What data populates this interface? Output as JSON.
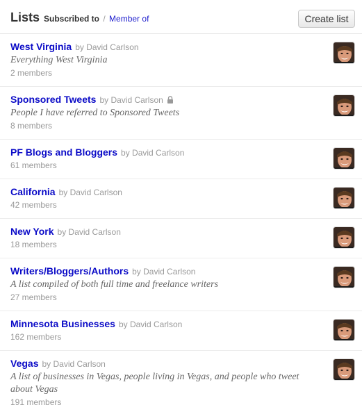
{
  "header": {
    "title": "Lists",
    "tab_subscribed": "Subscribed to",
    "tab_separator": "/",
    "tab_member": "Member of",
    "create_button": "Create list"
  },
  "lists": [
    {
      "name": "West Virginia",
      "by": "by David Carlson",
      "locked": false,
      "description": "Everything West Virginia",
      "members": "2 members"
    },
    {
      "name": "Sponsored Tweets",
      "by": "by David Carlson",
      "locked": true,
      "description": "People I have referred to Sponsored Tweets",
      "members": "8 members"
    },
    {
      "name": "PF Blogs and Bloggers",
      "by": "by David Carlson",
      "locked": false,
      "description": "",
      "members": "61 members"
    },
    {
      "name": "California",
      "by": "by David Carlson",
      "locked": false,
      "description": "",
      "members": "42 members"
    },
    {
      "name": "New York",
      "by": "by David Carlson",
      "locked": false,
      "description": "",
      "members": "18 members"
    },
    {
      "name": "Writers/Bloggers/Authors",
      "by": "by David Carlson",
      "locked": false,
      "description": "A list compiled of both full time and freelance writers",
      "members": "27 members"
    },
    {
      "name": "Minnesota Businesses",
      "by": "by David Carlson",
      "locked": false,
      "description": "",
      "members": "162 members"
    },
    {
      "name": "Vegas",
      "by": "by David Carlson",
      "locked": false,
      "description": "A list of businesses in Vegas, people living in Vegas, and people who tweet about Vegas",
      "members": "191 members"
    }
  ],
  "icons": {
    "lock": "lock-icon",
    "avatar": "user-avatar"
  },
  "colors": {
    "link": "#0b0bc7",
    "muted": "#999999",
    "text": "#333333"
  }
}
